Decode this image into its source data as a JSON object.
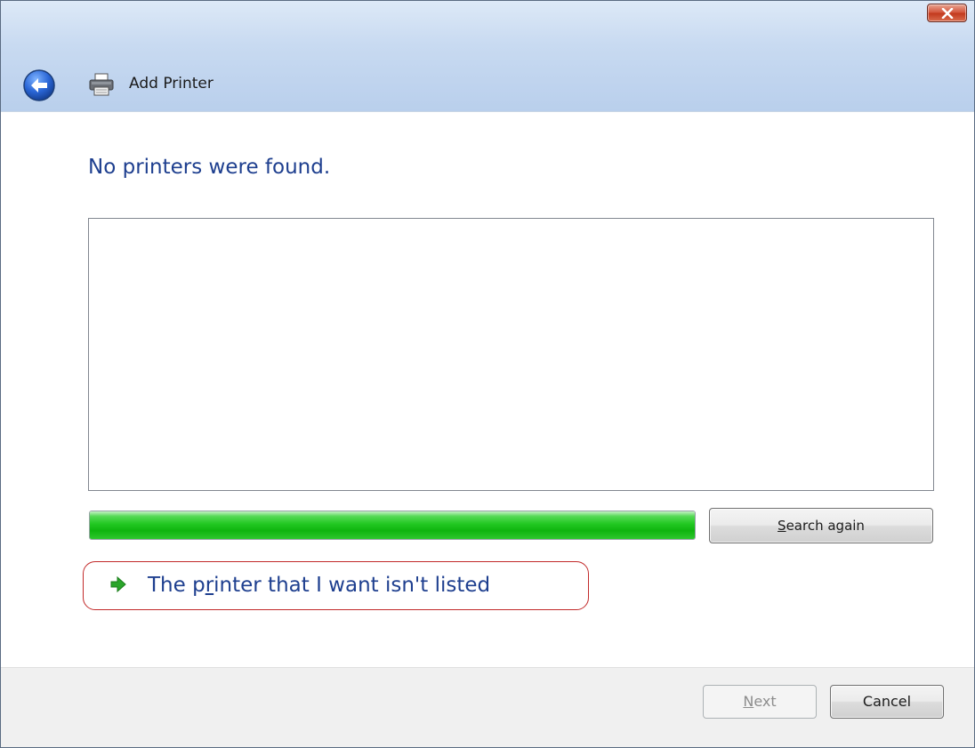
{
  "window": {
    "title": "Add Printer",
    "close_icon": "close-x-icon",
    "back_icon": "back-arrow-icon",
    "app_icon": "printer-icon"
  },
  "main": {
    "heading": "No printers were found.",
    "printer_list": [],
    "search_progress": 1.0,
    "search_button": {
      "label": "Search again",
      "accelerator": "S"
    },
    "not_listed_link": {
      "label": "The printer that I want isn't listed",
      "accelerator": "r",
      "icon": "green-arrow-icon",
      "highlight_color": "#c22a2a"
    }
  },
  "footer": {
    "next_button": {
      "label": "Next",
      "accelerator": "N",
      "enabled": false
    },
    "cancel_button": {
      "label": "Cancel"
    }
  },
  "colors": {
    "heading": "#1e3f8f",
    "progress": "#22c822",
    "titlebar": "#c8daf1"
  }
}
